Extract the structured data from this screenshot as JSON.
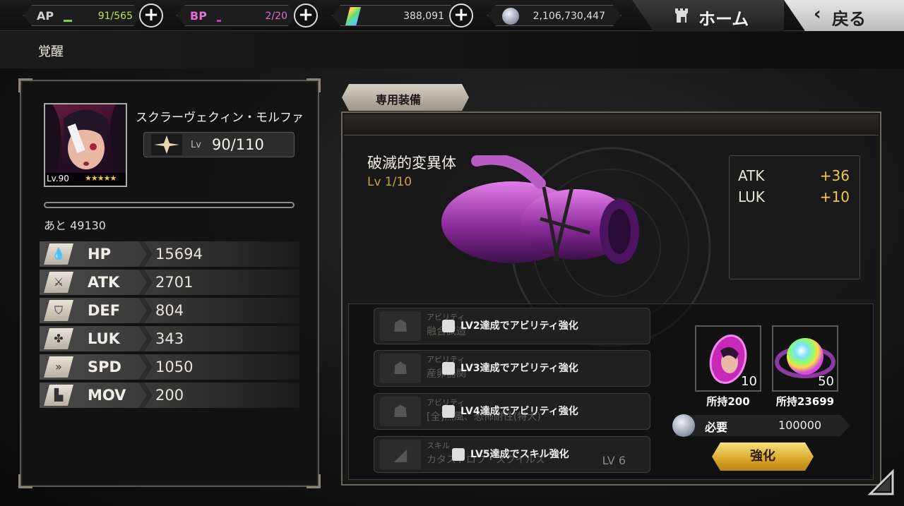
{
  "topbar": {
    "ap": {
      "label": "AP",
      "value": "91/565",
      "value_color": "#b8e44a",
      "fraction": 0.161
    },
    "bp": {
      "label": "BP",
      "value": "2/20",
      "value_color": "#e66bd8",
      "fraction": 0.1
    },
    "gem": {
      "value": "388,091",
      "icon": "crystal-icon"
    },
    "coin": {
      "value": "2,106,730,447",
      "icon": "coin-icon"
    },
    "home_label": "ホーム",
    "back_label": "戻る"
  },
  "page_title": "覚醒",
  "character": {
    "name": "スクラーヴェクィン・モルファ",
    "level_label": "Lv",
    "level": "90/110",
    "portrait_level": "Lv.90",
    "stars": "★★★★★",
    "exp_remaining": "あと 49130",
    "exp_fraction": 0.0,
    "stats": [
      {
        "name": "HP",
        "value": "15694",
        "icon": "drop-icon"
      },
      {
        "name": "ATK",
        "value": "2701",
        "icon": "sword-icon"
      },
      {
        "name": "DEF",
        "value": "804",
        "icon": "shield-icon"
      },
      {
        "name": "LUK",
        "value": "343",
        "icon": "clover-icon"
      },
      {
        "name": "SPD",
        "value": "1050",
        "icon": "speed-icon"
      },
      {
        "name": "MOV",
        "value": "200",
        "icon": "boot-icon"
      }
    ]
  },
  "equipment": {
    "tab_label": "専用装備",
    "name": "破滅的変異体",
    "level": "Lv 1/10",
    "bonus": [
      {
        "stat": "ATK",
        "value": "+36"
      },
      {
        "stat": "LUK",
        "value": "+10"
      }
    ],
    "abilities": [
      {
        "kind": "アビリティ",
        "name": "融合試造",
        "lock_text": "LV2達成でアビリティ強化",
        "lv": ""
      },
      {
        "kind": "アビリティ",
        "name": "産卵器関",
        "lock_text": "LV3達成でアビリティ強化",
        "lv": ""
      },
      {
        "kind": "アビリティ",
        "name": "[全]熱風、恐怖耐性(特大)",
        "lock_text": "LV4達成でアビリティ強化",
        "lv": ""
      },
      {
        "kind": "スキル",
        "name": "カタストロフ・スクイルズ",
        "lock_text": "LV5達成でスキル強化",
        "lv": "LV 6"
      }
    ],
    "materials": [
      {
        "count": "10",
        "owned": "所持200",
        "icon": "pink-gem-icon"
      },
      {
        "count": "50",
        "owned": "所持23699",
        "icon": "rainbow-orb-icon"
      }
    ],
    "need_label": "必要",
    "need_value": "100000",
    "enhance_label": "強化"
  },
  "colors": {
    "gold": "#f3c74a",
    "accent_purple": "#a13ea6"
  }
}
